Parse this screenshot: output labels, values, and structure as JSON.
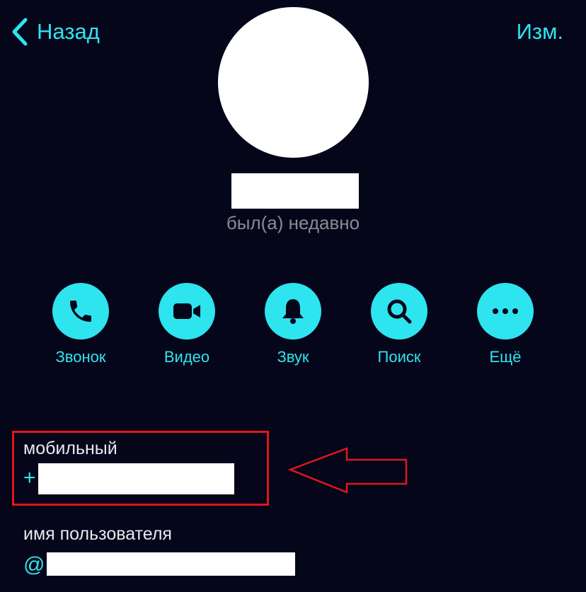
{
  "nav": {
    "back_label": "Назад",
    "edit_label": "Изм."
  },
  "profile": {
    "status": "был(а) недавно"
  },
  "actions": [
    {
      "label": "Звонок",
      "icon": "phone-icon"
    },
    {
      "label": "Видео",
      "icon": "video-camera-icon"
    },
    {
      "label": "Звук",
      "icon": "bell-icon"
    },
    {
      "label": "Поиск",
      "icon": "search-icon"
    },
    {
      "label": "Ещё",
      "icon": "more-dots-icon"
    }
  ],
  "fields": {
    "mobile": {
      "label": "мобильный",
      "prefix": "+"
    },
    "username": {
      "label": "имя пользователя",
      "prefix": "@"
    }
  },
  "colors": {
    "accent": "#2ee4ee",
    "background": "#05061a",
    "annotation": "#e0161b",
    "status_text": "#8a8a94"
  }
}
